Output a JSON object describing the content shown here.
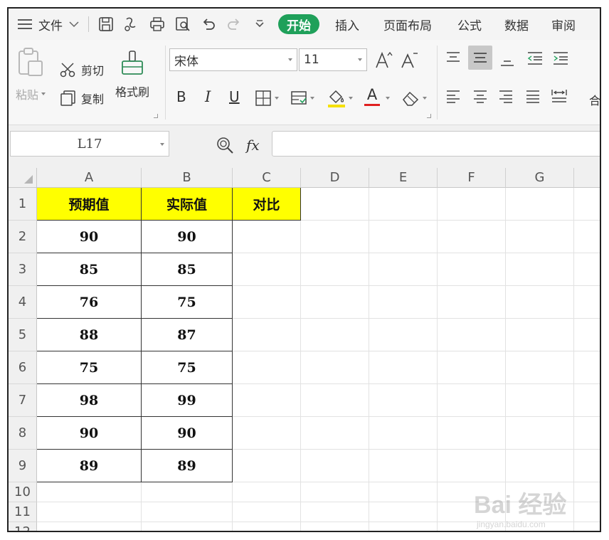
{
  "tabbar": {
    "menu_icon": "menu-icon",
    "file_label": "文件",
    "quick_access": [
      "save-icon",
      "format-painter-icon",
      "print-icon",
      "print-preview-icon",
      "undo-icon",
      "redo-icon",
      "customize-icon"
    ],
    "tabs": [
      {
        "label": "开始",
        "active": true
      },
      {
        "label": "插入",
        "active": false
      },
      {
        "label": "页面布局",
        "active": false
      },
      {
        "label": "公式",
        "active": false
      },
      {
        "label": "数据",
        "active": false
      },
      {
        "label": "审阅",
        "active": false
      }
    ]
  },
  "ribbon": {
    "paste_label": "粘贴",
    "cut_label": "剪切",
    "copy_label": "复制",
    "format_painter_label": "格式刷",
    "font_name": "宋体",
    "font_size": "11",
    "bold_label": "B",
    "italic_label": "I",
    "underline_label": "U",
    "font_color_label": "A",
    "merge_label": "合"
  },
  "formula_bar": {
    "cell_ref": "L17",
    "fx_label": "fx",
    "formula": ""
  },
  "grid": {
    "columns": [
      "A",
      "B",
      "C",
      "D",
      "E",
      "F",
      "G"
    ],
    "rows": [
      "1",
      "2",
      "3",
      "4",
      "5",
      "6",
      "7",
      "8",
      "9",
      "10",
      "11",
      "12"
    ],
    "header_row": [
      "预期值",
      "实际值",
      "对比"
    ],
    "data": [
      [
        "90",
        "90"
      ],
      [
        "85",
        "85"
      ],
      [
        "76",
        "75"
      ],
      [
        "88",
        "87"
      ],
      [
        "75",
        "75"
      ],
      [
        "98",
        "99"
      ],
      [
        "90",
        "90"
      ],
      [
        "89",
        "89"
      ]
    ],
    "header_color": "#ffff00"
  },
  "watermark": {
    "brand": "Bai 经验",
    "url": "jingyan.baidu.com"
  },
  "colors": {
    "active_tab": "#1fa05a",
    "font_color_underline": "#e02020",
    "fill_color_underline": "#f5e000"
  }
}
